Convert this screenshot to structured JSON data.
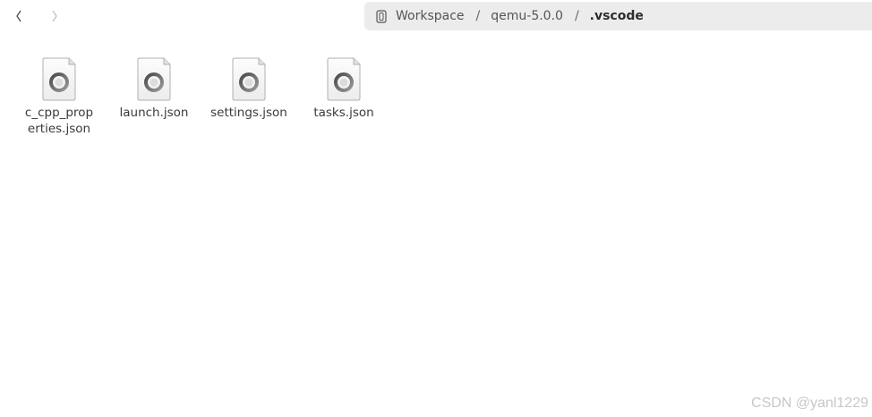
{
  "nav": {
    "back_icon": "chevron-left-icon",
    "forward_icon": "chevron-right-icon"
  },
  "breadcrumb": {
    "root_icon": "drive-icon",
    "items": [
      "Workspace",
      "qemu-5.0.0",
      ".vscode"
    ],
    "separator": "/"
  },
  "files": [
    {
      "name_line1": "c_cpp_prop",
      "name_line2": "erties.json",
      "icon": "json-file-icon"
    },
    {
      "name_line1": "launch.json",
      "name_line2": "",
      "icon": "json-file-icon"
    },
    {
      "name_line1": "settings.json",
      "name_line2": "",
      "icon": "json-file-icon"
    },
    {
      "name_line1": "tasks.json",
      "name_line2": "",
      "icon": "json-file-icon"
    }
  ],
  "watermark": "CSDN @yanl1229"
}
